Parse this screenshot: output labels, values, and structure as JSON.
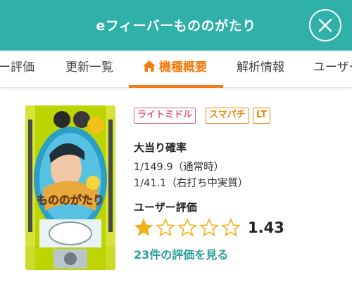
{
  "header": {
    "title": "eフィーバーもののがたり",
    "close_icon": "close-icon"
  },
  "tabs": [
    {
      "label": "ー評価"
    },
    {
      "label": "更新一覧"
    },
    {
      "label": "機種概要",
      "active": true,
      "icon": "home-icon"
    },
    {
      "label": "解析情報"
    },
    {
      "label": "ユーザー"
    }
  ],
  "product": {
    "image": "pachinko-machine-image",
    "tags": [
      "ライトミドル",
      "スマパチ",
      "LT"
    ],
    "jackpot_probability_label": "大当り確率",
    "probabilities": [
      "1/149.9（通常時）",
      "1/41.1（右打ち中実質）"
    ],
    "user_rating_label": "ユーザー評価",
    "rating_value": "1.43",
    "rating_stars": 1.43,
    "rating_max": 5,
    "reviews_link": "23件の評価を見る"
  },
  "colors": {
    "header_bg": "#2fb1a9",
    "active_tab": "#f07d13",
    "tag_pink": "#e05b8d",
    "tag_orange": "#e08a13",
    "link": "#2a9e9a"
  }
}
